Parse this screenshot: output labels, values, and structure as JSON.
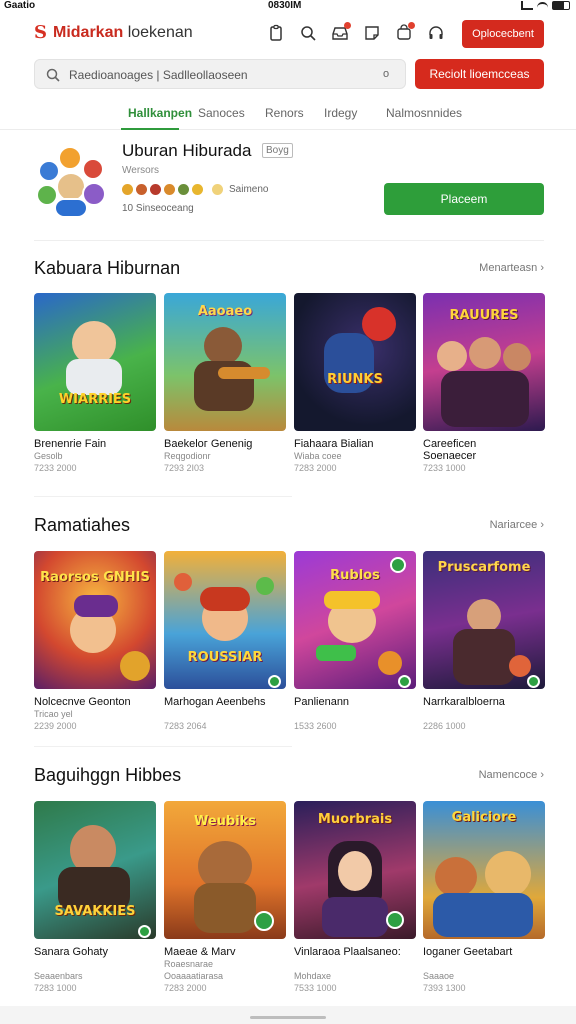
{
  "status": {
    "left": "Gaatio",
    "center": "0830IM"
  },
  "header": {
    "logo_mark": "S",
    "brand": "Midarkan",
    "brand_suffix": "loekenan",
    "action_button": "Oplocecbent"
  },
  "search": {
    "text": "Raedioanoages | Sadlleollaoseen",
    "clear": "o",
    "button": "Reciolt lioemcceas"
  },
  "tabs": [
    "Hallkanpen",
    "Sanoces",
    "Renors",
    "Irdegy",
    "Nalmosnnides"
  ],
  "profile": {
    "name": "Uburan Hiburada",
    "tag": "Boyg",
    "subtitle": "Wersors",
    "badge_label": "Saimeno",
    "stats": "10 Sinseoceang",
    "follow_button": "Placeem"
  },
  "sections": [
    {
      "title": "Kabuara Hiburnan",
      "more": "Menarteasn",
      "items": [
        {
          "title": "Brenenrie Fain",
          "subtitle": "Gesolb",
          "stats": "7233 2000",
          "art_text": "WIARRIES"
        },
        {
          "title": "Baekeloг Genenig",
          "subtitle": "Reqgodionr",
          "stats": "7293 2I03",
          "art_text": "Aaoaeo"
        },
        {
          "title": "Fiahaara Bialian",
          "subtitle": "Wiaba coee",
          "stats": "7283 2000",
          "art_text": "RIUNKS"
        },
        {
          "title": "Careeficen",
          "title2": "Soenaecer",
          "subtitle": "",
          "stats": "7233 1000",
          "art_text": "RAUURES"
        }
      ]
    },
    {
      "title": "Ramatiahes",
      "more": "Nariarcee",
      "items": [
        {
          "title": "Nolcecnve Geonton",
          "subtitle": "Tricao yel",
          "stats": "2239 2000",
          "art_text": "Raorsos GNHIS"
        },
        {
          "title": "Marhogan Aeenbehs",
          "subtitle": "",
          "stats": "7283 2064",
          "art_text": "ROUSSIAR"
        },
        {
          "title": "Panlienann",
          "subtitle": "",
          "stats": "1533 2600",
          "art_text": "Rublos"
        },
        {
          "title": "Narrkaralbloerna",
          "subtitle": "",
          "stats": "2286 1000",
          "art_text": "Pruscarfome"
        }
      ]
    },
    {
      "title": "Baguihggn Hibbes",
      "more": "Namencoce",
      "items": [
        {
          "title": "Sanara Gohaty",
          "subtitle": "Seaaenbars",
          "stats": "7283 1000",
          "art_text": "SAVAKKIES"
        },
        {
          "title": "Maeae & Marv",
          "subtitle": "Roaesnarae",
          "subtitle2": "Ooaaaatiarasa",
          "stats": "7283 2000",
          "art_text": "Weubiks"
        },
        {
          "title": "Vinlaraoa Plaalsaneo:",
          "subtitle": "Mohdaxe",
          "stats": "7533 1000",
          "art_text": "Muorbrais"
        },
        {
          "title": "Ioganer Geetabart",
          "subtitle": "Saaaoe",
          "stats": "7393 1300",
          "art_text": "Galiciore"
        }
      ]
    }
  ],
  "colors": {
    "accent_red": "#d42a1e",
    "accent_green": "#2e9e3a"
  }
}
